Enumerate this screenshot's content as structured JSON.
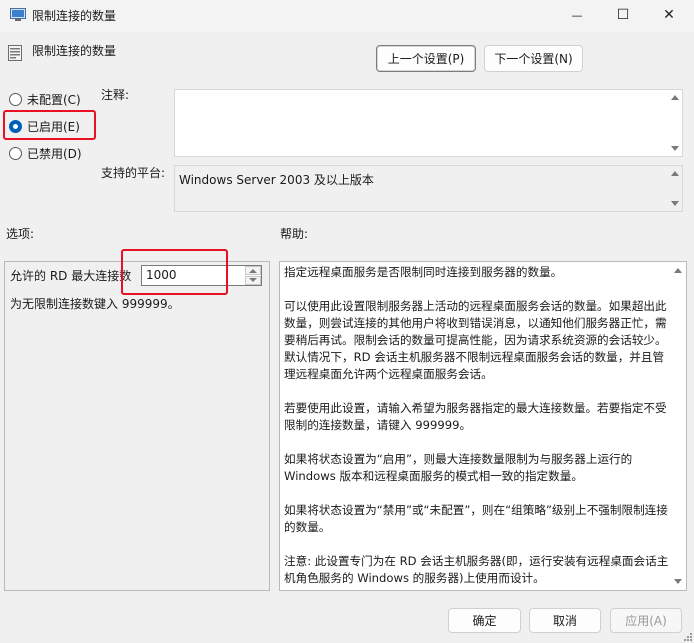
{
  "window": {
    "title": "限制连接的数量",
    "min_glyph": "—",
    "max_glyph": "☐",
    "close_glyph": "✕"
  },
  "header": {
    "policy_name": "限制连接的数量",
    "prev_label": "上一个设置(P)",
    "next_label": "下一个设置(N)"
  },
  "state": {
    "options": [
      {
        "label": "未配置(C)",
        "checked": false
      },
      {
        "label": "已启用(E)",
        "checked": true
      },
      {
        "label": "已禁用(D)",
        "checked": false
      }
    ]
  },
  "comment": {
    "label": "注释:",
    "value": ""
  },
  "platform": {
    "label": "支持的平台:",
    "value": "Windows Server 2003 及以上版本"
  },
  "options_pane": {
    "label": "选项:",
    "max_connections_label": "允许的 RD 最大连接数",
    "max_connections_value": "1000",
    "hint": "为无限制连接数键入 999999。"
  },
  "help_pane": {
    "label": "帮助:",
    "paragraphs": [
      "指定远程桌面服务是否限制同时连接到服务器的数量。",
      "可以使用此设置限制服务器上活动的远程桌面服务会话的数量。如果超出此数量，则尝试连接的其他用户将收到错误消息，以通知他们服务器正忙，需要稍后再试。限制会话的数量可提高性能，因为请求系统资源的会话较少。默认情况下，RD 会话主机服务器不限制远程桌面服务会话的数量，并且管理远程桌面允许两个远程桌面服务会话。",
      "若要使用此设置，请输入希望为服务器指定的最大连接数量。若要指定不受限制的连接数量，请键入 999999。",
      "如果将状态设置为“启用”，则最大连接数量限制为与服务器上运行的 Windows 版本和远程桌面服务的模式相一致的指定数量。",
      "如果将状态设置为“禁用”或“未配置”，则在“组策略”级别上不强制限制连接的数量。",
      "注意: 此设置专门为在 RD 会话主机服务器(即，运行安装有远程桌面会话主机角色服务的 Windows 的服务器)上使用而设计。"
    ]
  },
  "footer": {
    "ok_label": "确定",
    "cancel_label": "取消",
    "apply_label": "应用(A)"
  },
  "colors": {
    "accent": "#005fb8",
    "highlight_box": "#e81123"
  },
  "icons": [
    "app-icon",
    "policy-icon",
    "minimize-icon",
    "maximize-icon",
    "close-icon",
    "spin-up-icon",
    "spin-down-icon",
    "resize-grip-icon"
  ]
}
